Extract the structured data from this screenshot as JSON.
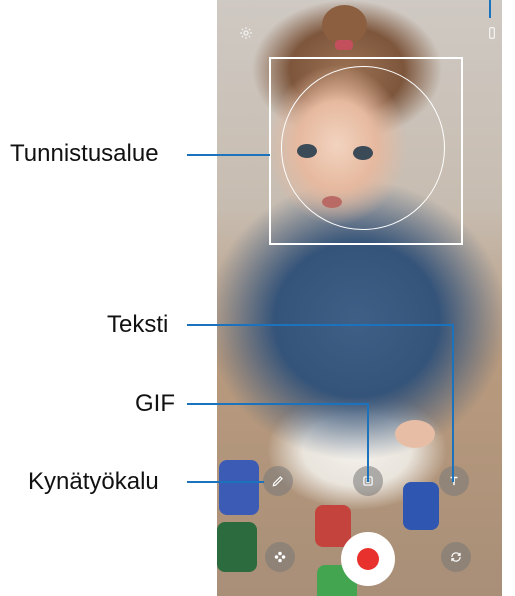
{
  "labels": {
    "detection_area": "Tunnistusalue",
    "text": "Teksti",
    "gif": "GIF",
    "pen_tool": "Kynätyökalu"
  },
  "icons": {
    "settings": "gear-icon",
    "pen": "pen-icon",
    "gif": "gif-icon",
    "text": "text-icon",
    "effects": "sparkle-icon",
    "switch_camera": "switch-camera-icon",
    "record": "record-button"
  },
  "colors": {
    "callout_line": "#1b73bd",
    "record_dot": "#e8312c"
  }
}
